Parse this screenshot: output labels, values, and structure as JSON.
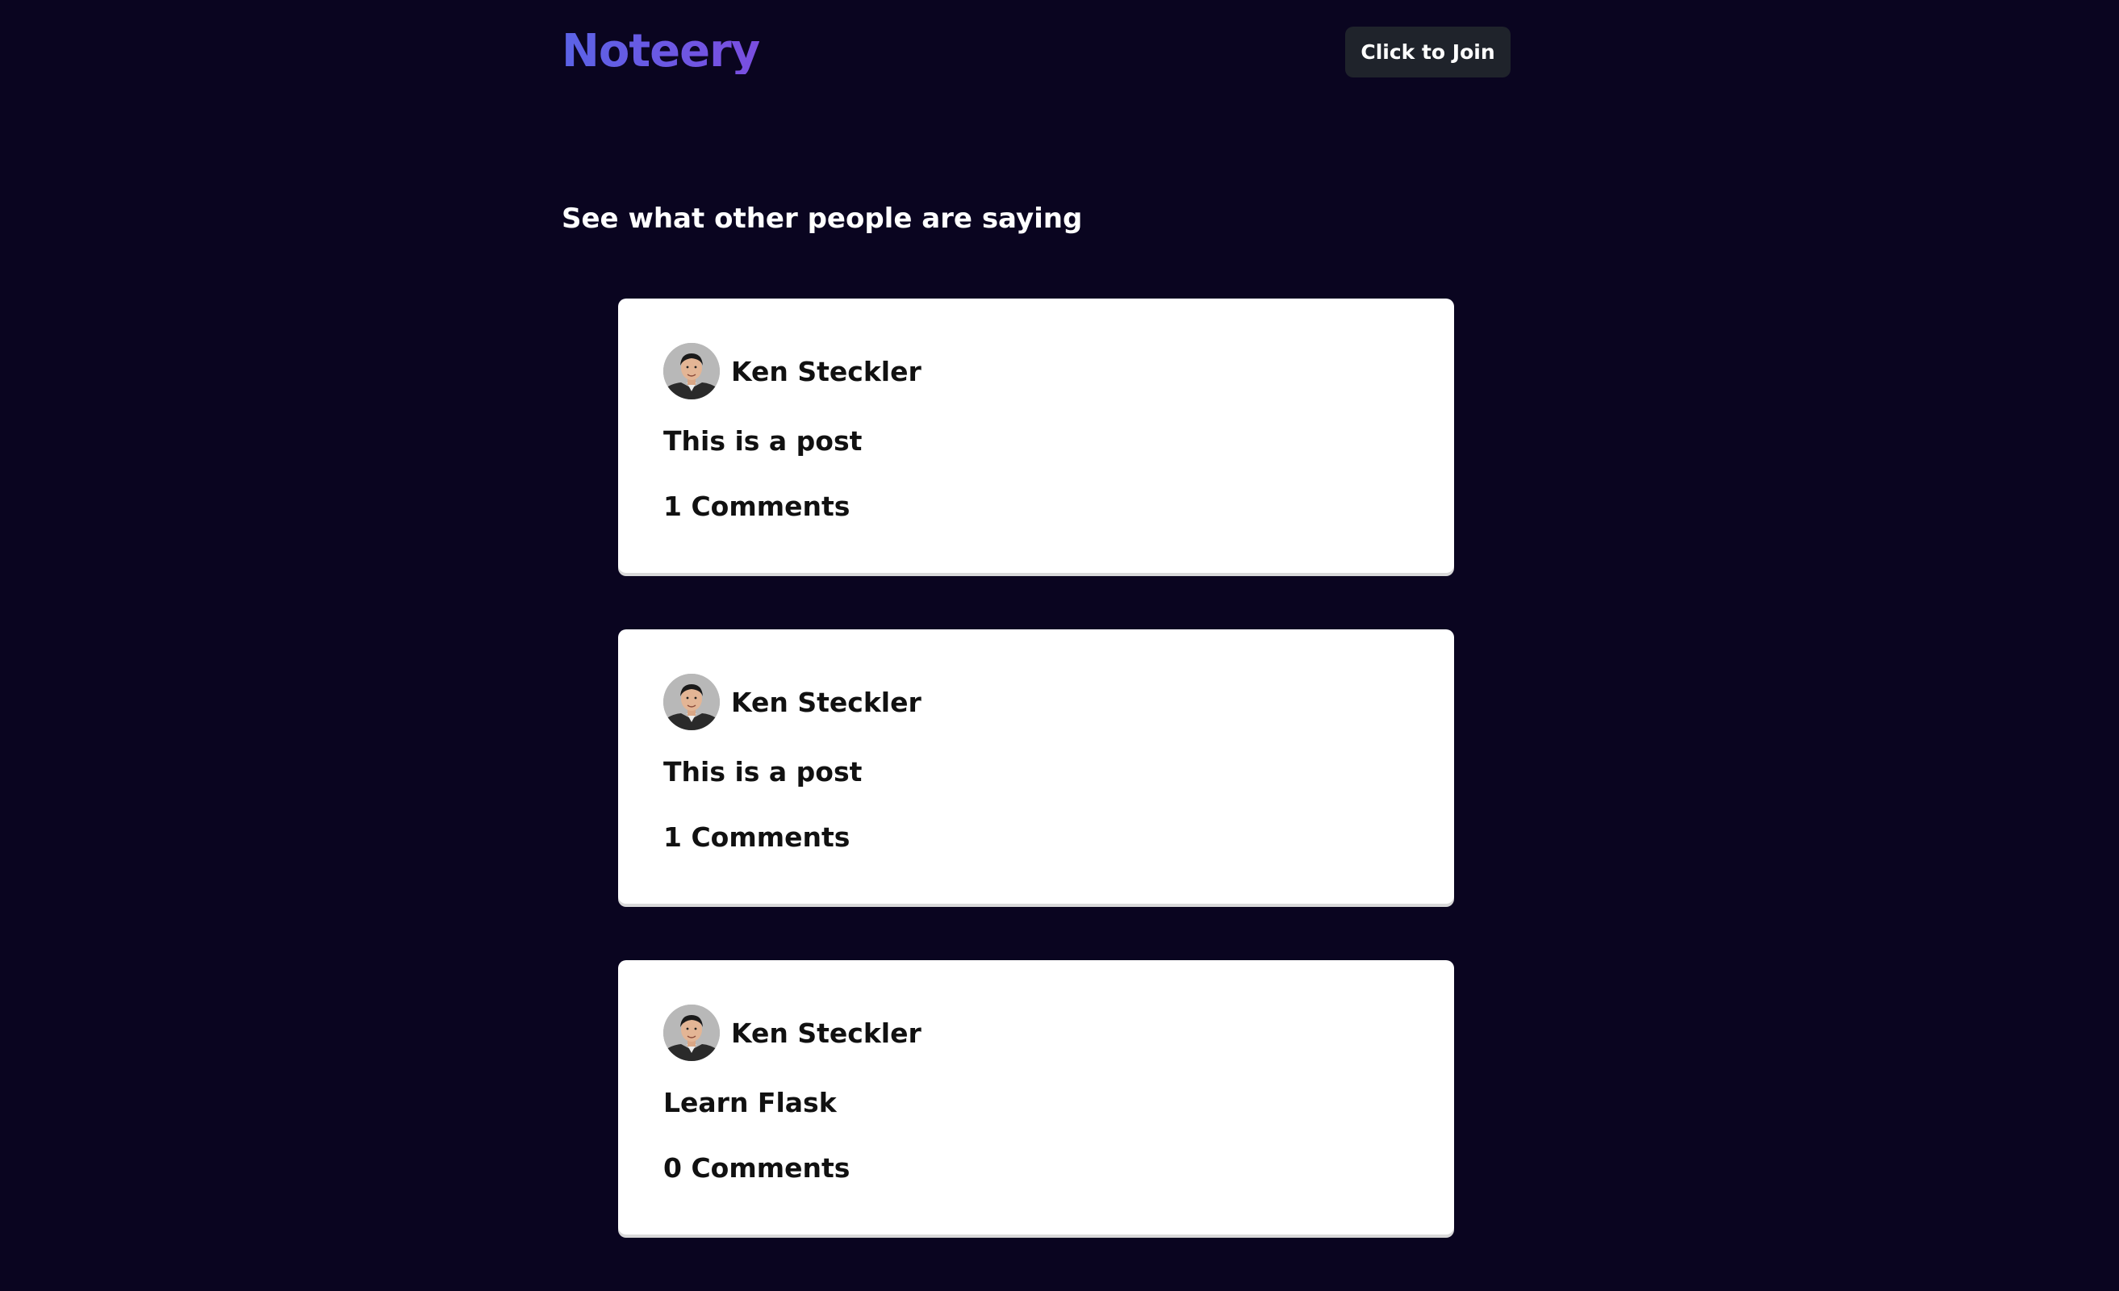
{
  "header": {
    "logo": "Noteery",
    "join_label": "Click to Join"
  },
  "main": {
    "heading": "See what other people are saying",
    "posts": [
      {
        "author": "Ken Steckler",
        "title": "This is a post",
        "comments": "1 Comments"
      },
      {
        "author": "Ken Steckler",
        "title": "This is a post",
        "comments": "1 Comments"
      },
      {
        "author": "Ken Steckler",
        "title": "Learn Flask",
        "comments": "0 Comments"
      }
    ]
  },
  "colors": {
    "background": "#0a0520",
    "logo_gradient_start": "#5b63e6",
    "logo_gradient_end": "#7a4ee0",
    "button_background": "#1f232b",
    "card_background": "#ffffff"
  }
}
